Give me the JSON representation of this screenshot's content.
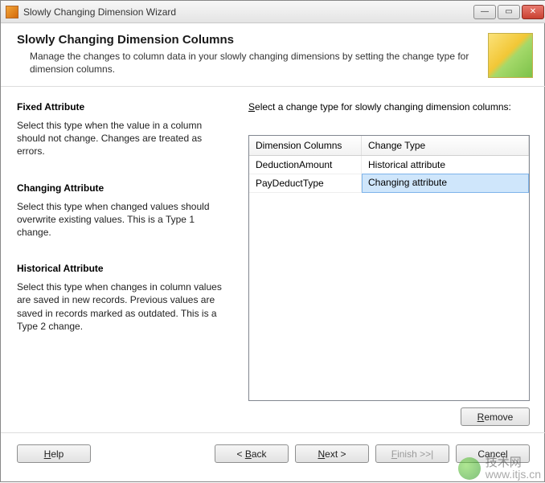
{
  "window": {
    "title": "Slowly Changing Dimension Wizard"
  },
  "header": {
    "title": "Slowly Changing Dimension Columns",
    "desc": "Manage the changes to column data in your slowly changing dimensions by setting the change type for dimension columns."
  },
  "left": {
    "fixed": {
      "title": "Fixed Attribute",
      "desc": "Select this type when the value in a column should not change. Changes are treated as errors."
    },
    "changing": {
      "title": "Changing Attribute",
      "desc": "Select this type when changed values should overwrite existing values. This is a Type 1 change."
    },
    "historical": {
      "title": "Historical Attribute",
      "desc": "Select this type when changes in column values are saved in new records. Previous values are saved in records marked as outdated. This is a Type 2 change."
    }
  },
  "right": {
    "label_pre": "S",
    "label_rest": "elect a change type for slowly changing dimension columns:",
    "columns": {
      "c1": "Dimension Columns",
      "c2": "Change Type"
    },
    "rows": [
      {
        "col": "DeductionAmount",
        "type": "Historical attribute",
        "selected": false
      },
      {
        "col": "PayDeductType",
        "type": "Changing attribute",
        "selected": true
      }
    ]
  },
  "buttons": {
    "remove_u": "R",
    "remove_rest": "emove",
    "help_u": "H",
    "help_rest": "elp",
    "back_pre": "< ",
    "back_u": "B",
    "back_rest": "ack",
    "next_u": "N",
    "next_rest": "ext >",
    "finish_u": "F",
    "finish_rest": "inish >>|",
    "cancel": "Cancel"
  },
  "watermark": {
    "cn": "技术网",
    "url": "www.itjs.cn"
  }
}
